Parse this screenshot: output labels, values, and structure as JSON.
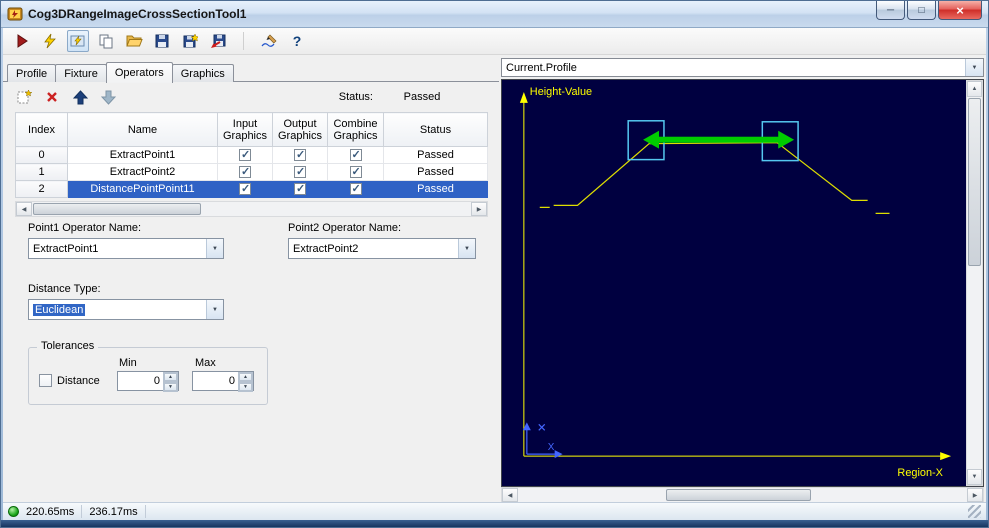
{
  "window": {
    "title": "Cog3DRangeImageCrossSectionTool1",
    "minimize_glyph": "─",
    "maximize_glyph": "□",
    "close_glyph": "×"
  },
  "glyphs": {
    "scroll_up": "▲",
    "scroll_down": "▼",
    "scroll_left": "◀",
    "scroll_right": "▶",
    "combo_arrow": "▼",
    "spin_up": "▲",
    "spin_down": "▼",
    "help": "?"
  },
  "toolbar": {
    "icons": [
      "run-icon",
      "run-electric-icon",
      "electric-display-toggle-icon",
      "copy-icon",
      "open-folder-icon",
      "save-icon",
      "save-image-icon",
      "import-icon",
      "signature-icon",
      "help-icon"
    ]
  },
  "tabs": {
    "active": "Operators",
    "items": [
      {
        "label": "Profile"
      },
      {
        "label": "Fixture"
      },
      {
        "label": "Operators"
      },
      {
        "label": "Graphics"
      }
    ]
  },
  "operators": {
    "status_label": "Status:",
    "status_value": "Passed",
    "table": {
      "columns": [
        "Index",
        "Name",
        "Input Graphics",
        "Output Graphics",
        "Combine Graphics",
        "Status"
      ],
      "rows": [
        {
          "index": "0",
          "name": "ExtractPoint1",
          "input_graphics": true,
          "output_graphics": true,
          "combine_graphics": true,
          "status": "Passed",
          "selected": false
        },
        {
          "index": "1",
          "name": "ExtractPoint2",
          "input_graphics": true,
          "output_graphics": true,
          "combine_graphics": true,
          "status": "Passed",
          "selected": false
        },
        {
          "index": "2",
          "name": "DistancePointPoint11",
          "input_graphics": true,
          "output_graphics": true,
          "combine_graphics": true,
          "status": "Passed",
          "selected": true
        }
      ]
    },
    "point1_label": "Point1 Operator Name:",
    "point1_value": "ExtractPoint1",
    "point2_label": "Point2 Operator Name:",
    "point2_value": "ExtractPoint2",
    "distance_type_label": "Distance Type:",
    "distance_type_value": "Euclidean",
    "tolerances": {
      "title": "Tolerances",
      "min_header": "Min",
      "max_header": "Max",
      "distance_label": "Distance",
      "distance_checked": false,
      "min_value": "0",
      "max_value": "0"
    }
  },
  "graphics": {
    "profile_selector": "Current.Profile",
    "chart": {
      "y_axis_label": "Height-Value",
      "x_axis_label": "Region-X",
      "origin_label": "X",
      "background": "#000040",
      "axis_color": "#ffff00",
      "profile_color": "#dede00",
      "marker_color": "#55c8f0",
      "arrow_color": "#00cc00",
      "mini_axis_color": "#4466ff"
    }
  },
  "status_bar": {
    "time1": "220.65ms",
    "time2": "236.17ms"
  }
}
